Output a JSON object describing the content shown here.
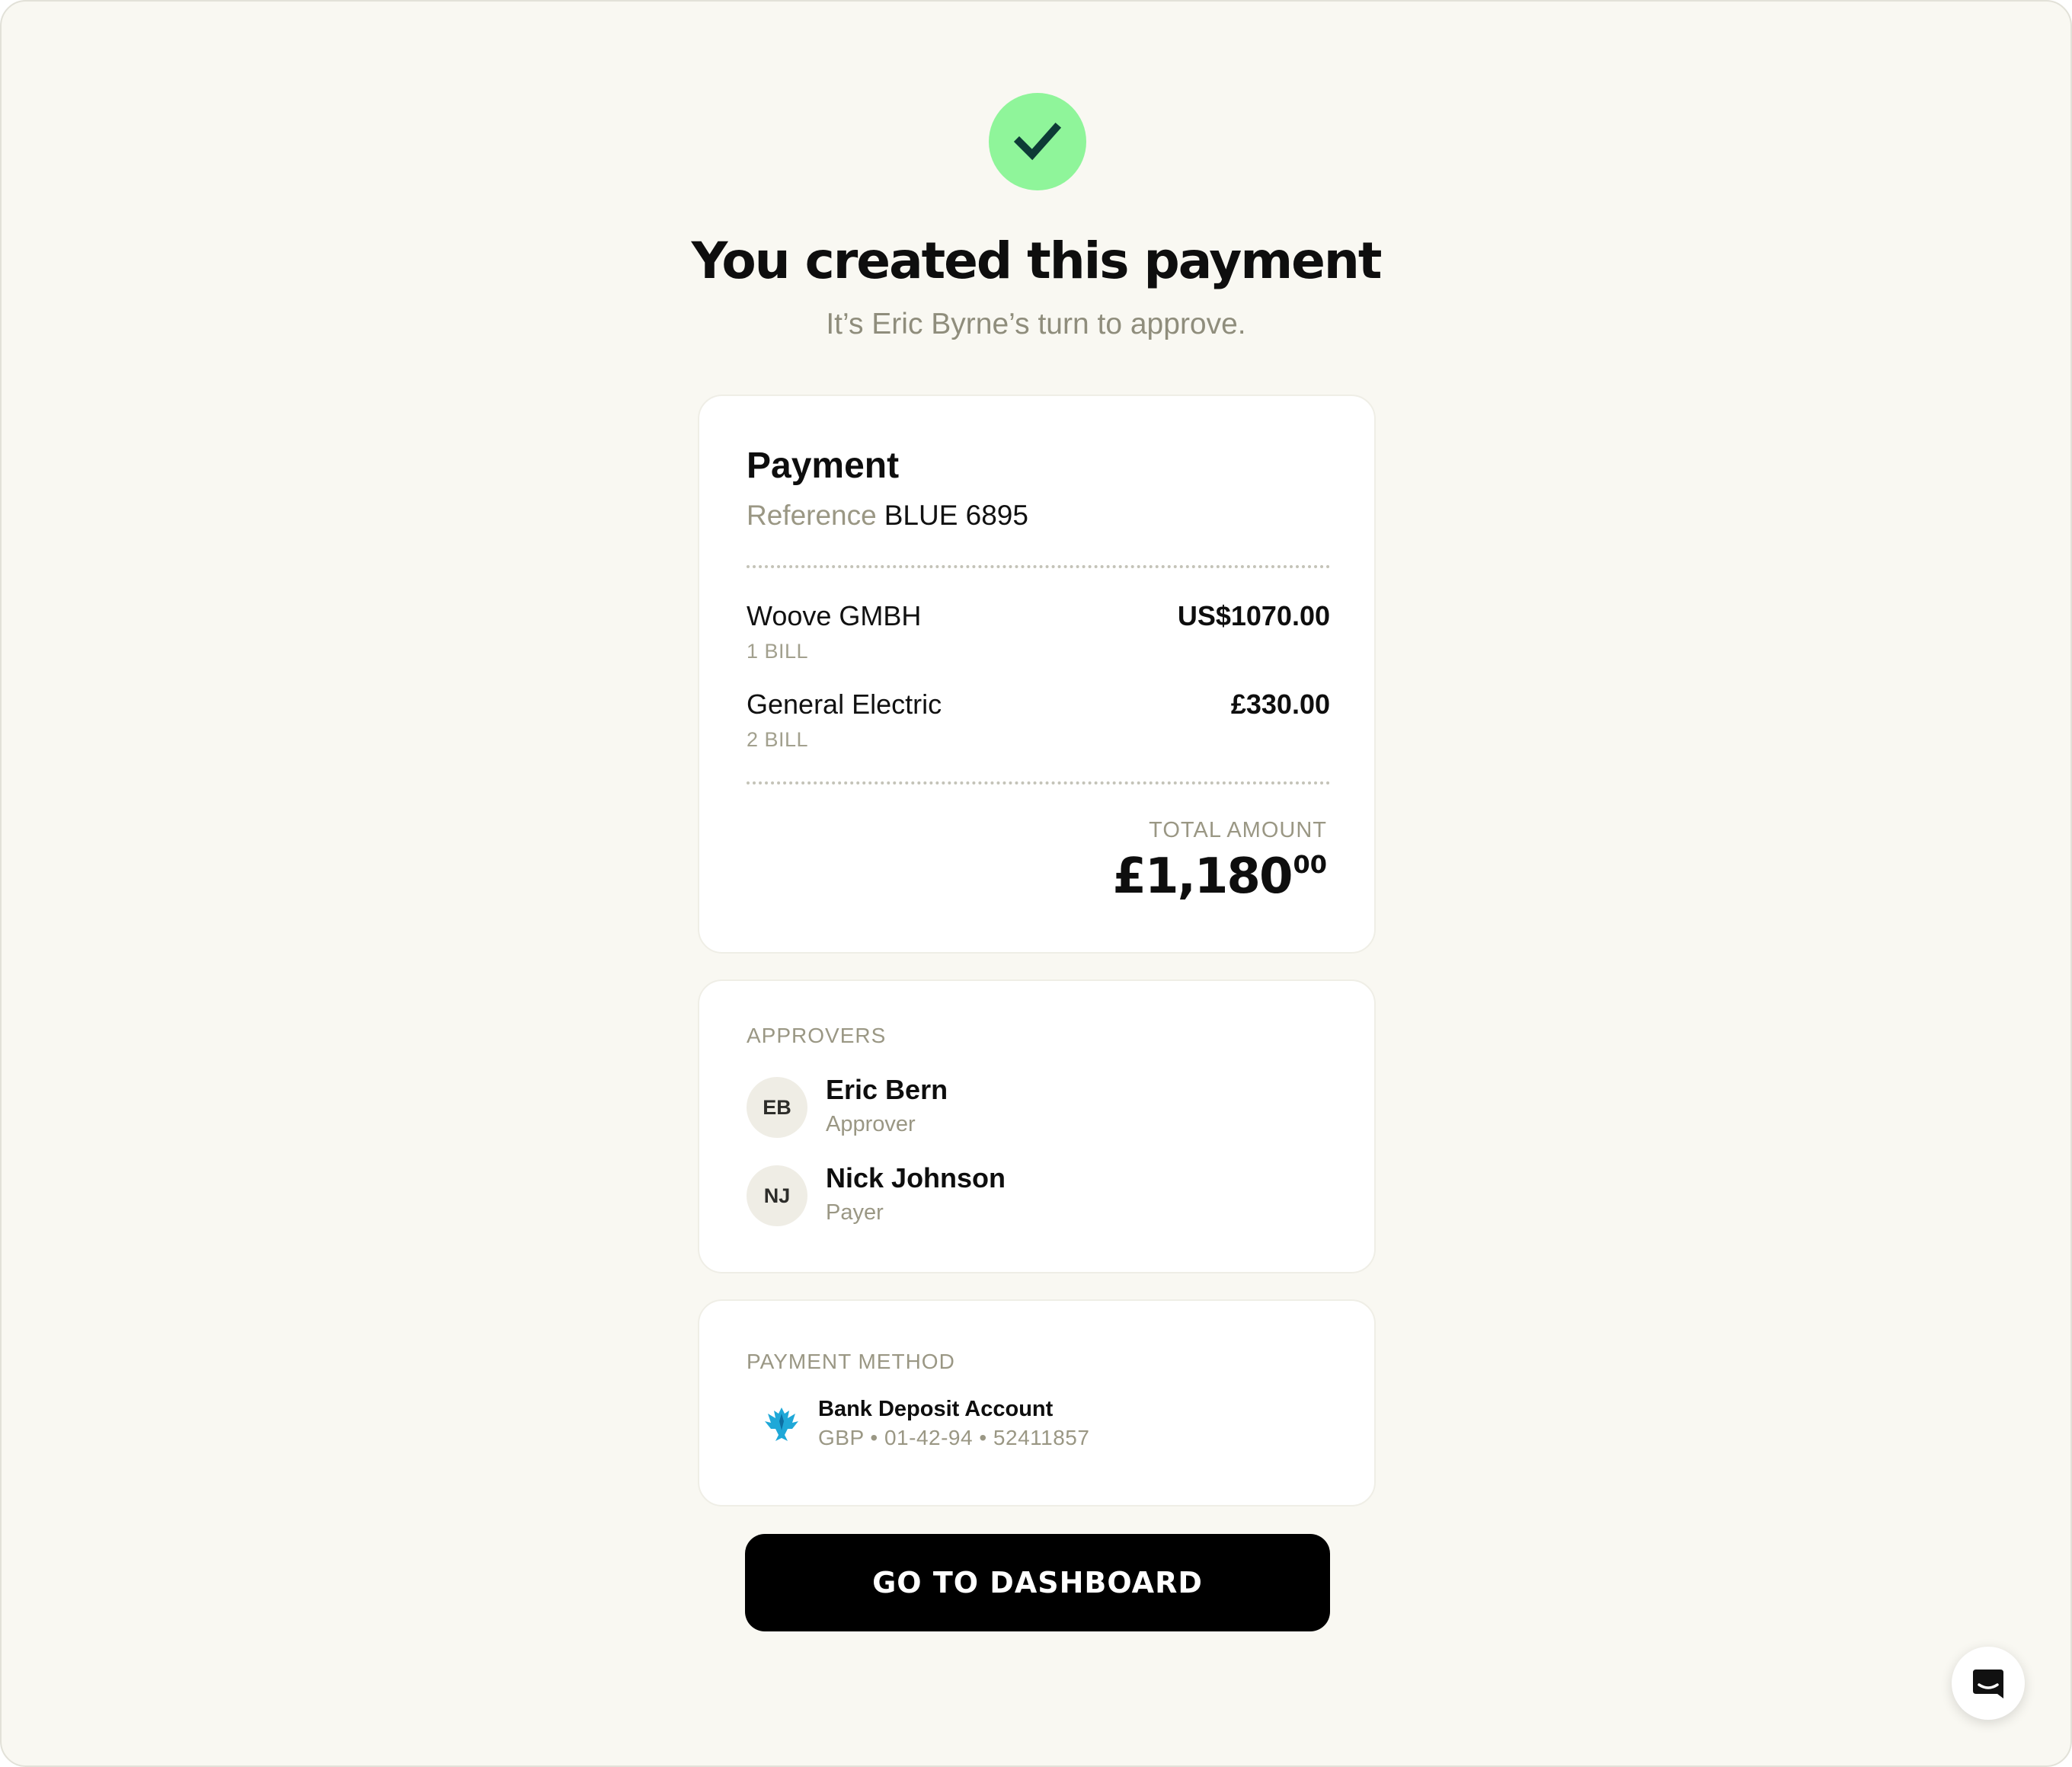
{
  "header": {
    "title": "You created this payment",
    "subtitle": "It’s Eric Byrne’s turn to approve."
  },
  "payment": {
    "title": "Payment",
    "reference_label": "Reference",
    "reference_value": "BLUE 6895",
    "items": [
      {
        "name": "Woove GMBH",
        "bills": "1 BILL",
        "amount": "US$1070.00"
      },
      {
        "name": "General Electric",
        "bills": "2 BILL",
        "amount": "£330.00"
      }
    ],
    "total_label": "TOTAL AMOUNT",
    "total_main": "£1,180",
    "total_cents": "00"
  },
  "approvers": {
    "label": "APPROVERS",
    "people": [
      {
        "initials": "EB",
        "name": "Eric Bern",
        "role": "Approver"
      },
      {
        "initials": "NJ",
        "name": "Nick Johnson",
        "role": "Payer"
      }
    ]
  },
  "payment_method": {
    "label": "PAYMENT METHOD",
    "account_name": "Bank Deposit Account",
    "account_details": "GBP • 01-42-94 • 52411857"
  },
  "actions": {
    "dashboard_label": "GO TO DASHBOARD"
  },
  "colors": {
    "background": "#f9f8f2",
    "success_green": "#8ff59a",
    "check_dark": "#0d3b36",
    "muted_text": "#9a9784",
    "button_black": "#000000"
  },
  "icons": {
    "success": "check-icon",
    "bank": "eagle-bank-icon",
    "chat": "chat-icon"
  }
}
